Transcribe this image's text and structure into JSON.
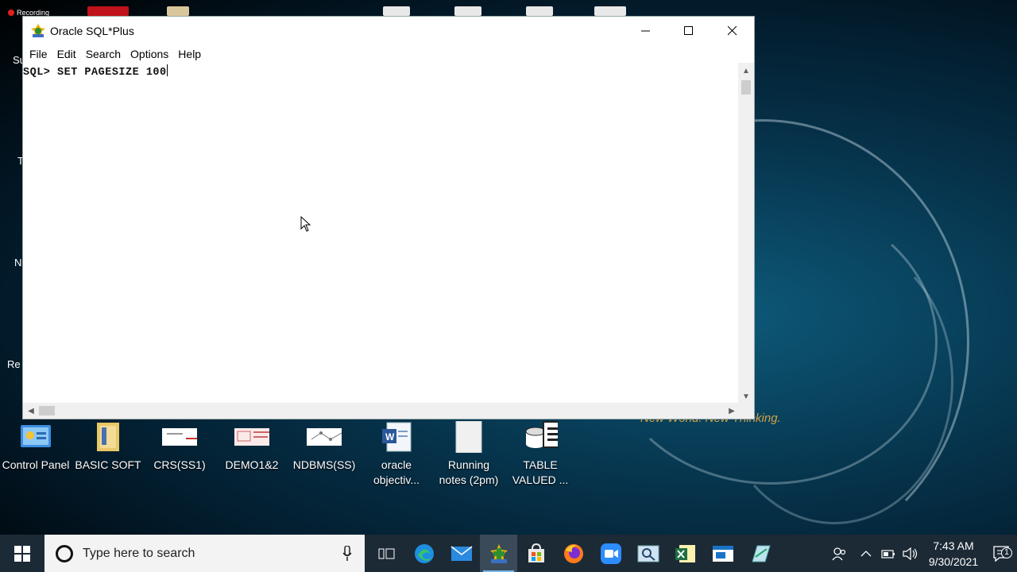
{
  "window": {
    "title": "Oracle SQL*Plus",
    "menus": [
      "File",
      "Edit",
      "Search",
      "Options",
      "Help"
    ],
    "console_text": "SQL> SET PAGESIZE 100"
  },
  "desktop": {
    "recording_label": "Recording",
    "tagline": "New World. New Thinking.",
    "edge_labels": [
      "Su",
      "T",
      "N",
      "Re"
    ],
    "icons": [
      {
        "label": "Control Panel",
        "icon": "control-panel-icon"
      },
      {
        "label": "BASIC SOFT",
        "icon": "folder-icon"
      },
      {
        "label": "CRS(SS1)",
        "icon": "document-thumbnail-icon"
      },
      {
        "label": "DEMO1&2",
        "icon": "document-thumbnail-icon"
      },
      {
        "label": "NDBMS(SS)",
        "icon": "document-thumbnail-icon"
      },
      {
        "label": "oracle objectiv...",
        "icon": "word-document-icon"
      },
      {
        "label": "Running notes (2pm)",
        "icon": "text-file-icon"
      },
      {
        "label": "TABLE VALUED ...",
        "icon": "database-icon"
      }
    ]
  },
  "taskbar": {
    "search_placeholder": "Type here to search",
    "pinned": [
      "task-view",
      "edge",
      "mail",
      "sqlplus",
      "store",
      "firefox",
      "zoom",
      "search-app",
      "excel",
      "explorer-app",
      "notepad"
    ],
    "clock_time": "7:43 AM",
    "clock_date": "9/30/2021",
    "notification_count": "1"
  },
  "colors": {
    "taskbar": "#1c2a36",
    "accent": "#76b9ed",
    "tagline": "#d3a247"
  }
}
